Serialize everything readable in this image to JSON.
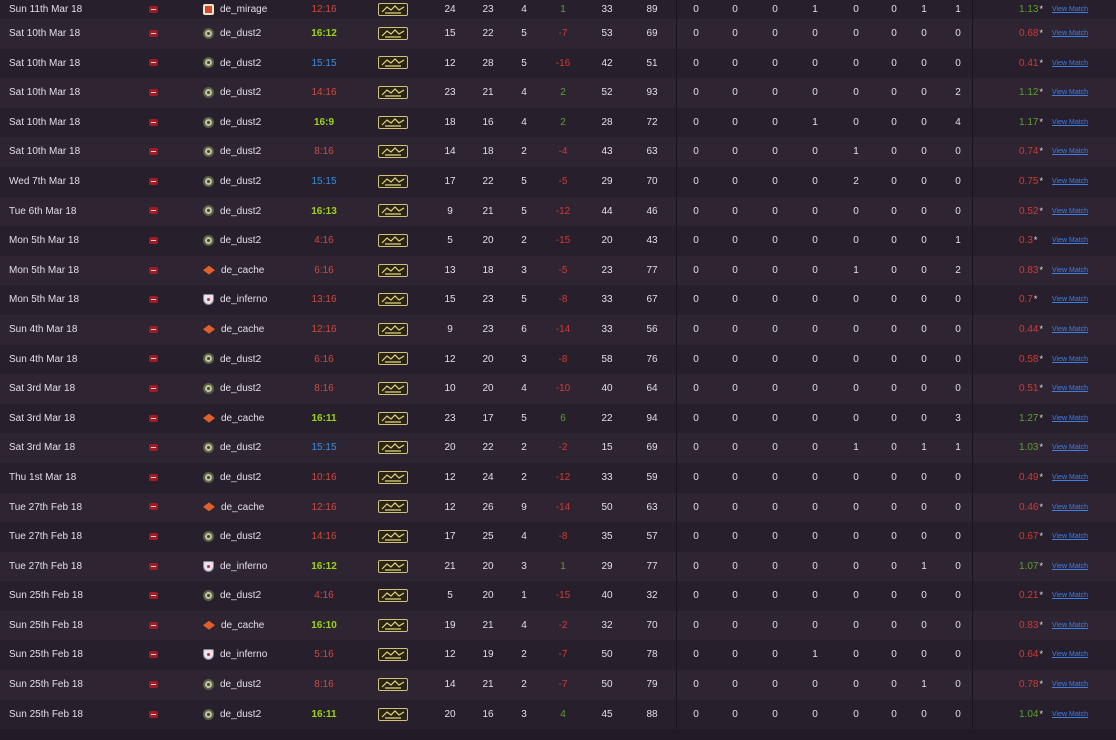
{
  "table": {
    "link_label": "View Match",
    "rating_star": "*",
    "rows": [
      {
        "date": "Sun 11th Mar 18",
        "map": "de_mirage",
        "map_icon": "mirage-icon",
        "score": "12:16",
        "result": "loss",
        "kills": "24",
        "assists": "23",
        "deaths": "4",
        "diff": "1",
        "hs": "33",
        "adr": "89",
        "a": "0",
        "b": "0",
        "c": "0",
        "d": "1",
        "e": "0",
        "f": "0",
        "g": "1",
        "h": "1",
        "rating": "1.13"
      },
      {
        "date": "Sat 10th Mar 18",
        "map": "de_dust2",
        "map_icon": "dust2-icon",
        "score": "16:12",
        "result": "win",
        "kills": "15",
        "assists": "22",
        "deaths": "5",
        "diff": "-7",
        "hs": "53",
        "adr": "69",
        "a": "0",
        "b": "0",
        "c": "0",
        "d": "0",
        "e": "0",
        "f": "0",
        "g": "0",
        "h": "0",
        "rating": "0.68"
      },
      {
        "date": "Sat 10th Mar 18",
        "map": "de_dust2",
        "map_icon": "dust2-icon",
        "score": "15:15",
        "result": "tie",
        "kills": "12",
        "assists": "28",
        "deaths": "5",
        "diff": "-16",
        "hs": "42",
        "adr": "51",
        "a": "0",
        "b": "0",
        "c": "0",
        "d": "0",
        "e": "0",
        "f": "0",
        "g": "0",
        "h": "0",
        "rating": "0.41"
      },
      {
        "date": "Sat 10th Mar 18",
        "map": "de_dust2",
        "map_icon": "dust2-icon",
        "score": "14:16",
        "result": "loss",
        "kills": "23",
        "assists": "21",
        "deaths": "4",
        "diff": "2",
        "hs": "52",
        "adr": "93",
        "a": "0",
        "b": "0",
        "c": "0",
        "d": "0",
        "e": "0",
        "f": "0",
        "g": "0",
        "h": "2",
        "rating": "1.12"
      },
      {
        "date": "Sat 10th Mar 18",
        "map": "de_dust2",
        "map_icon": "dust2-icon",
        "score": "16:9",
        "result": "win",
        "kills": "18",
        "assists": "16",
        "deaths": "4",
        "diff": "2",
        "hs": "28",
        "adr": "72",
        "a": "0",
        "b": "0",
        "c": "0",
        "d": "1",
        "e": "0",
        "f": "0",
        "g": "0",
        "h": "4",
        "rating": "1.17"
      },
      {
        "date": "Sat 10th Mar 18",
        "map": "de_dust2",
        "map_icon": "dust2-icon",
        "score": "8:16",
        "result": "loss",
        "kills": "14",
        "assists": "18",
        "deaths": "2",
        "diff": "-4",
        "hs": "43",
        "adr": "63",
        "a": "0",
        "b": "0",
        "c": "0",
        "d": "0",
        "e": "1",
        "f": "0",
        "g": "0",
        "h": "0",
        "rating": "0.74"
      },
      {
        "date": "Wed 7th Mar 18",
        "map": "de_dust2",
        "map_icon": "dust2-icon",
        "score": "15:15",
        "result": "tie",
        "kills": "17",
        "assists": "22",
        "deaths": "5",
        "diff": "-5",
        "hs": "29",
        "adr": "70",
        "a": "0",
        "b": "0",
        "c": "0",
        "d": "0",
        "e": "2",
        "f": "0",
        "g": "0",
        "h": "0",
        "rating": "0.75"
      },
      {
        "date": "Tue 6th Mar 18",
        "map": "de_dust2",
        "map_icon": "dust2-icon",
        "score": "16:13",
        "result": "win",
        "kills": "9",
        "assists": "21",
        "deaths": "5",
        "diff": "-12",
        "hs": "44",
        "adr": "46",
        "a": "0",
        "b": "0",
        "c": "0",
        "d": "0",
        "e": "0",
        "f": "0",
        "g": "0",
        "h": "0",
        "rating": "0.52"
      },
      {
        "date": "Mon 5th Mar 18",
        "map": "de_dust2",
        "map_icon": "dust2-icon",
        "score": "4:16",
        "result": "loss",
        "kills": "5",
        "assists": "20",
        "deaths": "2",
        "diff": "-15",
        "hs": "20",
        "adr": "43",
        "a": "0",
        "b": "0",
        "c": "0",
        "d": "0",
        "e": "0",
        "f": "0",
        "g": "0",
        "h": "1",
        "rating": "0.3"
      },
      {
        "date": "Mon 5th Mar 18",
        "map": "de_cache",
        "map_icon": "cache-icon",
        "score": "6:16",
        "result": "loss",
        "kills": "13",
        "assists": "18",
        "deaths": "3",
        "diff": "-5",
        "hs": "23",
        "adr": "77",
        "a": "0",
        "b": "0",
        "c": "0",
        "d": "0",
        "e": "1",
        "f": "0",
        "g": "0",
        "h": "2",
        "rating": "0.83"
      },
      {
        "date": "Mon 5th Mar 18",
        "map": "de_inferno",
        "map_icon": "inferno-icon",
        "score": "13:16",
        "result": "loss",
        "kills": "15",
        "assists": "23",
        "deaths": "5",
        "diff": "-8",
        "hs": "33",
        "adr": "67",
        "a": "0",
        "b": "0",
        "c": "0",
        "d": "0",
        "e": "0",
        "f": "0",
        "g": "0",
        "h": "0",
        "rating": "0.7"
      },
      {
        "date": "Sun 4th Mar 18",
        "map": "de_cache",
        "map_icon": "cache-icon",
        "score": "12:16",
        "result": "loss",
        "kills": "9",
        "assists": "23",
        "deaths": "6",
        "diff": "-14",
        "hs": "33",
        "adr": "56",
        "a": "0",
        "b": "0",
        "c": "0",
        "d": "0",
        "e": "0",
        "f": "0",
        "g": "0",
        "h": "0",
        "rating": "0.44"
      },
      {
        "date": "Sun 4th Mar 18",
        "map": "de_dust2",
        "map_icon": "dust2-icon",
        "score": "6:16",
        "result": "loss",
        "kills": "12",
        "assists": "20",
        "deaths": "3",
        "diff": "-8",
        "hs": "58",
        "adr": "76",
        "a": "0",
        "b": "0",
        "c": "0",
        "d": "0",
        "e": "0",
        "f": "0",
        "g": "0",
        "h": "0",
        "rating": "0.58"
      },
      {
        "date": "Sat 3rd Mar 18",
        "map": "de_dust2",
        "map_icon": "dust2-icon",
        "score": "8:16",
        "result": "loss",
        "kills": "10",
        "assists": "20",
        "deaths": "4",
        "diff": "-10",
        "hs": "40",
        "adr": "64",
        "a": "0",
        "b": "0",
        "c": "0",
        "d": "0",
        "e": "0",
        "f": "0",
        "g": "0",
        "h": "0",
        "rating": "0.51"
      },
      {
        "date": "Sat 3rd Mar 18",
        "map": "de_cache",
        "map_icon": "cache-icon",
        "score": "16:11",
        "result": "win",
        "kills": "23",
        "assists": "17",
        "deaths": "5",
        "diff": "6",
        "hs": "22",
        "adr": "94",
        "a": "0",
        "b": "0",
        "c": "0",
        "d": "0",
        "e": "0",
        "f": "0",
        "g": "0",
        "h": "3",
        "rating": "1.27"
      },
      {
        "date": "Sat 3rd Mar 18",
        "map": "de_dust2",
        "map_icon": "dust2-icon",
        "score": "15:15",
        "result": "tie",
        "kills": "20",
        "assists": "22",
        "deaths": "2",
        "diff": "-2",
        "hs": "15",
        "adr": "69",
        "a": "0",
        "b": "0",
        "c": "0",
        "d": "0",
        "e": "1",
        "f": "0",
        "g": "1",
        "h": "1",
        "rating": "1.03"
      },
      {
        "date": "Thu 1st Mar 18",
        "map": "de_dust2",
        "map_icon": "dust2-icon",
        "score": "10:16",
        "result": "loss",
        "kills": "12",
        "assists": "24",
        "deaths": "2",
        "diff": "-12",
        "hs": "33",
        "adr": "59",
        "a": "0",
        "b": "0",
        "c": "0",
        "d": "0",
        "e": "0",
        "f": "0",
        "g": "0",
        "h": "0",
        "rating": "0.49"
      },
      {
        "date": "Tue 27th Feb 18",
        "map": "de_cache",
        "map_icon": "cache-icon",
        "score": "12:16",
        "result": "loss",
        "kills": "12",
        "assists": "26",
        "deaths": "9",
        "diff": "-14",
        "hs": "50",
        "adr": "63",
        "a": "0",
        "b": "0",
        "c": "0",
        "d": "0",
        "e": "0",
        "f": "0",
        "g": "0",
        "h": "0",
        "rating": "0.46"
      },
      {
        "date": "Tue 27th Feb 18",
        "map": "de_dust2",
        "map_icon": "dust2-icon",
        "score": "14:16",
        "result": "loss",
        "kills": "17",
        "assists": "25",
        "deaths": "4",
        "diff": "-8",
        "hs": "35",
        "adr": "57",
        "a": "0",
        "b": "0",
        "c": "0",
        "d": "0",
        "e": "0",
        "f": "0",
        "g": "0",
        "h": "0",
        "rating": "0.67"
      },
      {
        "date": "Tue 27th Feb 18",
        "map": "de_inferno",
        "map_icon": "inferno-icon",
        "score": "16:12",
        "result": "win",
        "kills": "21",
        "assists": "20",
        "deaths": "3",
        "diff": "1",
        "hs": "29",
        "adr": "77",
        "a": "0",
        "b": "0",
        "c": "0",
        "d": "0",
        "e": "0",
        "f": "0",
        "g": "1",
        "h": "0",
        "rating": "1.07"
      },
      {
        "date": "Sun 25th Feb 18",
        "map": "de_dust2",
        "map_icon": "dust2-icon",
        "score": "4:16",
        "result": "loss",
        "kills": "5",
        "assists": "20",
        "deaths": "1",
        "diff": "-15",
        "hs": "40",
        "adr": "32",
        "a": "0",
        "b": "0",
        "c": "0",
        "d": "0",
        "e": "0",
        "f": "0",
        "g": "0",
        "h": "0",
        "rating": "0.21"
      },
      {
        "date": "Sun 25th Feb 18",
        "map": "de_cache",
        "map_icon": "cache-icon",
        "score": "16:10",
        "result": "win",
        "kills": "19",
        "assists": "21",
        "deaths": "4",
        "diff": "-2",
        "hs": "32",
        "adr": "70",
        "a": "0",
        "b": "0",
        "c": "0",
        "d": "0",
        "e": "0",
        "f": "0",
        "g": "0",
        "h": "0",
        "rating": "0.83"
      },
      {
        "date": "Sun 25th Feb 18",
        "map": "de_inferno",
        "map_icon": "inferno-icon",
        "score": "5:16",
        "result": "loss",
        "kills": "12",
        "assists": "19",
        "deaths": "2",
        "diff": "-7",
        "hs": "50",
        "adr": "78",
        "a": "0",
        "b": "0",
        "c": "0",
        "d": "1",
        "e": "0",
        "f": "0",
        "g": "0",
        "h": "0",
        "rating": "0.64"
      },
      {
        "date": "Sun 25th Feb 18",
        "map": "de_dust2",
        "map_icon": "dust2-icon",
        "score": "8:16",
        "result": "loss",
        "kills": "14",
        "assists": "21",
        "deaths": "2",
        "diff": "-7",
        "hs": "50",
        "adr": "79",
        "a": "0",
        "b": "0",
        "c": "0",
        "d": "0",
        "e": "0",
        "f": "0",
        "g": "1",
        "h": "0",
        "rating": "0.78"
      },
      {
        "date": "Sun 25th Feb 18",
        "map": "de_dust2",
        "map_icon": "dust2-icon",
        "score": "16:11",
        "result": "win",
        "kills": "20",
        "assists": "16",
        "deaths": "3",
        "diff": "4",
        "hs": "45",
        "adr": "88",
        "a": "0",
        "b": "0",
        "c": "0",
        "d": "0",
        "e": "0",
        "f": "0",
        "g": "0",
        "h": "0",
        "rating": "1.04"
      }
    ]
  },
  "colors": {
    "background": "#221a26",
    "row_odd": "#281f2c",
    "row_even": "#2e2432",
    "win": "#9bd21e",
    "loss": "#d04a3e",
    "tie": "#3a8edb",
    "positive": "#5aa130",
    "negative": "#cf3b35",
    "link": "#3c7ee8"
  },
  "icons": {
    "provider": "faceit-badge-icon",
    "rank": "rank-badge-icon"
  }
}
